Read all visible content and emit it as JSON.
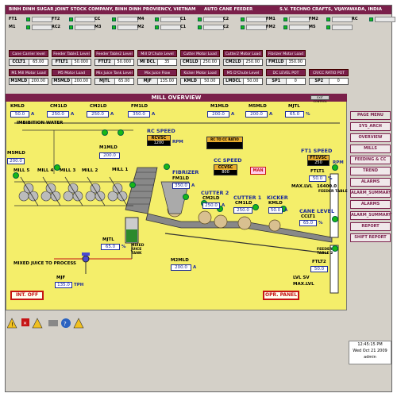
{
  "header": {
    "company": "BINH DINH SUGAR JOINT STOCK COMPANY, BINH DINH PROVIENCY, VIETNAM",
    "system": "AUTO CANE FEEDER",
    "vendor": "S.V. TECHNO CRAFTS, VIJAYAWADA, INDIA"
  },
  "indicators_row1": [
    "FT1",
    "FT2",
    "CC",
    "M4",
    "C1",
    "C2",
    "FM1",
    "FM2",
    "RC"
  ],
  "indicators_row2": [
    "M1",
    "RC2",
    "M3",
    "M2",
    "C1",
    "C2",
    "FM2",
    "M5"
  ],
  "metrics_row1": [
    {
      "title": "Cane Carrier level",
      "tag": "CCLT1",
      "value": "65.00"
    },
    {
      "title": "Feeder Table1 Level",
      "tag": "FTLT1",
      "value": "50.000"
    },
    {
      "title": "Feeder Table2 Level",
      "tag": "FTLT2",
      "value": "50.000"
    },
    {
      "title": "Mill D'Chute Level",
      "tag": "MI DCL",
      "value": "35"
    },
    {
      "title": "Cutter Motor Load",
      "tag": "CM1LD",
      "value": "250.00"
    },
    {
      "title": "Cutter2 Motor Load",
      "tag": "CM2LD",
      "value": "250.00"
    },
    {
      "title": "Fibrizer Motor Load",
      "tag": "FM1LD",
      "value": "350.00"
    }
  ],
  "metrics_row2": [
    {
      "title": "M1 Mill Motor Load",
      "tag": "M1MLD",
      "value": "200.00"
    },
    {
      "title": "M5 Motor Load",
      "tag": "M5MLD",
      "value": "200.00"
    },
    {
      "title": "Mix Juice Tank Level",
      "tag": "MJTL",
      "value": "65.00"
    },
    {
      "title": "Mix Juice Flow",
      "tag": "MJF",
      "value": "135.00"
    },
    {
      "title": "Kicker Motor Load",
      "tag": "KMLD",
      "value": "50.00"
    },
    {
      "title": "M5 D'Chute Level",
      "tag": "LMDCL",
      "value": "50.00"
    },
    {
      "title": "DC LEVEL POT",
      "tag": "SP1",
      "value": "0"
    },
    {
      "title": "CR/CC RATIO POT",
      "tag": "SP2",
      "value": "0"
    }
  ],
  "right_ind": {
    "page_menu": "PAGE MENU"
  },
  "mill": {
    "title": "MILL OVERVIEW",
    "exit_label": "EXIT CONTROL",
    "kmld": {
      "label": "KMLD",
      "value": "50.0",
      "unit": "A"
    },
    "cm1ld": {
      "label": "CM1LD",
      "value": "250.0",
      "unit": "A"
    },
    "cm2ld": {
      "label": "CM2LD",
      "value": "250.0",
      "unit": "A"
    },
    "fm1ld": {
      "label": "FM1LD",
      "value": "350.0",
      "unit": "A"
    },
    "m1mld": {
      "label": "M1MLD",
      "value": "200.0",
      "unit": "A"
    },
    "m5mld": {
      "label": "M5MLD",
      "value": "200.0",
      "unit": "A"
    },
    "mjtl": {
      "label": "MJTL",
      "value": "65.0",
      "unit": "%"
    },
    "imbibition": "IMBIBITION WATER",
    "m5mld_left": {
      "label": "M5MLD",
      "value": "200.0"
    },
    "m1mld_mid": {
      "label": "M1MLD",
      "value": "200.0"
    },
    "mill_labels": [
      "MILL 5",
      "MILL 4",
      "MILL 3",
      "MILL 2",
      "MILL 1"
    ],
    "rc_speed": {
      "title": "RC SPEED",
      "tag": "RCVSC",
      "value": "1200",
      "unit": "RPM"
    },
    "rc_cc_ratio": "RC TO CC RATIO",
    "cc_speed": {
      "title": "CC SPEED",
      "tag": "CCVSC",
      "value": "800"
    },
    "man": "MAN",
    "fibrizer": {
      "title": "FIBRIZER",
      "tag": "FM1LD",
      "value": "350.0",
      "unit": "A"
    },
    "cutter2": {
      "title": "CUTTER 2",
      "tag": "CM2LD",
      "value": "250.0",
      "unit": "A"
    },
    "cutter1": {
      "title": "CUTTER 1",
      "tag": "CM1LD",
      "value": "250.0"
    },
    "kicker": {
      "title": "KICKER",
      "tag": "KMLD",
      "value": "50.0",
      "unit": "A"
    },
    "cane_level": {
      "title": "CANE LEVEL",
      "tag": "CCLT1",
      "value": "65.0",
      "unit": "%"
    },
    "ft1": {
      "title": "FT1 SPEED",
      "tag": "FT1VSC",
      "value": "250",
      "unit": "RPM",
      "lt_tag": "FTLT1",
      "lt": "50.0",
      "unit2": "%"
    },
    "max_lvl": "MAX.LVL",
    "ft1_max": "16400.0",
    "ft1_table": "FEEDER TABLE 1",
    "mjtl_mid": {
      "tag": "MJTL",
      "value": "65.0",
      "unit": "%"
    },
    "mixed_tank": "MIXED JUICE TANK",
    "m2mld": {
      "label": "M2MLD",
      "value": "200.0",
      "unit": "A"
    },
    "mixed_process": "MIXED JUICE TO PROCESS",
    "mjf": {
      "tag": "MJF",
      "value": "135.0",
      "unit": "TPH"
    },
    "ft2_table": "FEEDER TABLE 2",
    "ftlt2": {
      "tag": "FTLT2",
      "value": "50.0"
    },
    "lvl_sv": "LVL SV",
    "max_lvl2": "MAX.LVL"
  },
  "menu": [
    "SYS_ARCH",
    "OVERVIEW",
    "MILLS",
    "FEEDING & CC",
    "TREND",
    "ALARMS",
    "ALARM_SUMMARY",
    "ALARMS",
    "ALARM_SUMMARY",
    "REPORT",
    "SHIFT REPORT"
  ],
  "bottom": {
    "int_off": "INT. OFF",
    "opr_panel": "OPR. PANEL"
  },
  "clock": {
    "time": "12:45:15 PM",
    "date": "Wed Oct 21 2009",
    "user": "admin"
  }
}
